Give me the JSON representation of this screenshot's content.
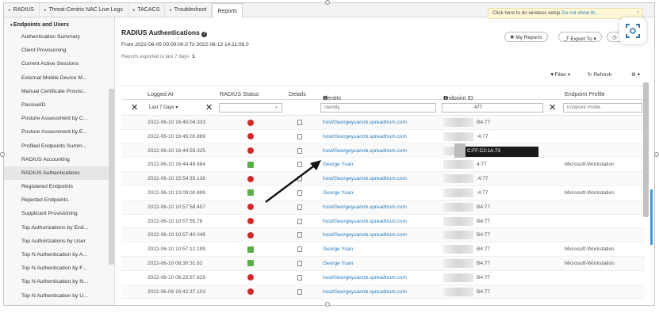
{
  "tabs": [
    {
      "label": "RADIUS",
      "caret": true
    },
    {
      "label": "Threat-Centric NAC Live Logs",
      "caret": true
    },
    {
      "label": "TACACS",
      "caret": true
    },
    {
      "label": "Troubleshoot",
      "caret": true
    },
    {
      "label": "Reports",
      "caret": false,
      "active": true
    }
  ],
  "notice": {
    "text": "Click here to do wireless setup",
    "link": "Do not show th...",
    "close": "×"
  },
  "sidebar": {
    "header": "Endpoints and Users",
    "items": [
      "Authentication Summary",
      "Client Provisioning",
      "Current Active Sessions",
      "External Mobile Device M...",
      "Manual Certificate Provisi...",
      "PassiveID",
      "Posture Assessment by C...",
      "Posture Assessment by E...",
      "Profiled Endpoints Summ...",
      "RADIUS Accounting",
      "RADIUS Authentications",
      "Registered Endpoints",
      "Rejected Endpoints",
      "Supplicant Provisioning",
      "Top Authorizations by End...",
      "Top Authorizations by User",
      "Top N Authentication by A...",
      "Top N Authentication by F...",
      "Top N Authentication by N...",
      "Top N Authentication by U..."
    ],
    "active_index": 10
  },
  "report": {
    "title": "RADIUS Authentications",
    "info_icon": "info-icon",
    "range": "From 2022-06-05 00:00:00.0 To 2022-06-12 14:11:08.0",
    "exported_label": "Reports exported in last 7 days",
    "exported_count": "1",
    "my_reports": "My Reports",
    "export_to": "Export To",
    "filter": "Filter",
    "refresh": "Refresh"
  },
  "columns": {
    "logged_at": "Logged At",
    "status": "RADIUS Status",
    "details": "Details",
    "identity": "Identity",
    "endpoint_id": "Endpoint ID",
    "endpoint_profile": "Endpoint Profile"
  },
  "filters": {
    "logged_at": "Last 7 Days",
    "identity_placeholder": "Identity",
    "endpoint_value": "477",
    "profile_placeholder": "Endpoint Profile"
  },
  "rows": [
    {
      "time": "2022-06-10 16:45:04.333",
      "status": "fail",
      "identity": "host/Georgeyuannb.spreadtrum.com",
      "endpoint": "B4:77",
      "profile": ""
    },
    {
      "time": "2022-06-10 16:45:00.869",
      "status": "fail",
      "identity": "host/Georgeyuannb.spreadtrum.com",
      "endpoint": ":4:77",
      "profile": ""
    },
    {
      "time": "2022-06-10 16:44:59.325",
      "status": "fail",
      "identity": "host/Georgeyuannb.spreadtrum.com",
      "endpoint": "",
      "profile": ""
    },
    {
      "time": "2022-06-10 16:44:49.684",
      "status": "pass",
      "identity": "George Yuan",
      "endpoint": "4:77",
      "profile": "Microsoft-Workstation"
    },
    {
      "time": "2022-06-10 15:54:33.136",
      "status": "fail",
      "identity": "host/Georgeyuannb.spreadtrum.com",
      "endpoint": ":4:77",
      "profile": ""
    },
    {
      "time": "2022-06-10 13:09:00.899",
      "status": "pass",
      "identity": "George Yuan",
      "endpoint": ":4:77",
      "profile": "Microsoft-Workstation"
    },
    {
      "time": "2022-06-10 10:57:58.457",
      "status": "fail",
      "identity": "host/Georgeyuannb.spreadtrum.com",
      "endpoint": "B4:77",
      "profile": ""
    },
    {
      "time": "2022-06-10 10:57:55.78",
      "status": "fail",
      "identity": "host/Georgeyuannb.spreadtrum.com",
      "endpoint": "B4:77",
      "profile": ""
    },
    {
      "time": "2022-06-10 10:57:40.049",
      "status": "fail",
      "identity": "host/Georgeyuannb.spreadtrum.com",
      "endpoint": "B4:77",
      "profile": ""
    },
    {
      "time": "2022-06-10 10:57:12.199",
      "status": "pass",
      "identity": "George Yuan",
      "endpoint": "B4:77",
      "profile": "Microsoft-Workstation"
    },
    {
      "time": "2022-06-10 08:30:31.62",
      "status": "pass",
      "identity": "George Yuan",
      "endpoint": "B4:77",
      "profile": "Microsoft-Workstation"
    },
    {
      "time": "2022-06-10 08:23:57.629",
      "status": "fail",
      "identity": "host/Georgeyuannb.spreadtrum.com",
      "endpoint": "B4:77",
      "profile": ""
    },
    {
      "time": "2022-06-09 16:42:37.103",
      "status": "fail",
      "identity": "host/Georgeyuannb.spreadtrum.com",
      "endpoint": "B4:77",
      "profile": ""
    }
  ],
  "tooltip": "C:FF:C2:1A:73",
  "colors": {
    "link": "#2a7ab8",
    "fail": "#cf2a27",
    "pass": "#5fab4c",
    "accent": "#3c9ad9"
  }
}
